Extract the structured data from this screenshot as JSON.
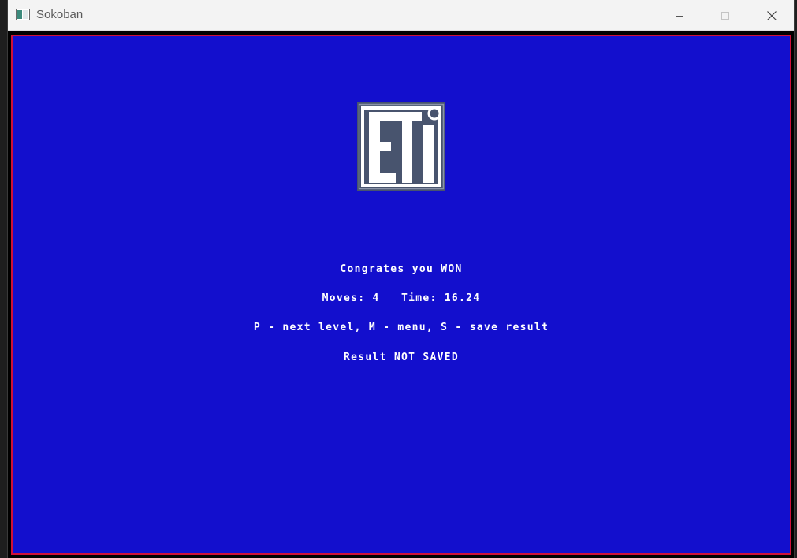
{
  "window": {
    "title": "Sokoban",
    "controls": {
      "minimize_icon": "minimize-icon",
      "maximize_icon": "maximize-icon",
      "close_icon": "close-icon"
    }
  },
  "game": {
    "background_color": "#130fcd",
    "border_color": "#d0103a",
    "logo_text": "ETI",
    "message": "Congrates you WON",
    "stats": "Moves: 4   Time: 16.24",
    "instructions": "P - next level, M - menu, S - save result",
    "save_status": "Result NOT SAVED"
  }
}
